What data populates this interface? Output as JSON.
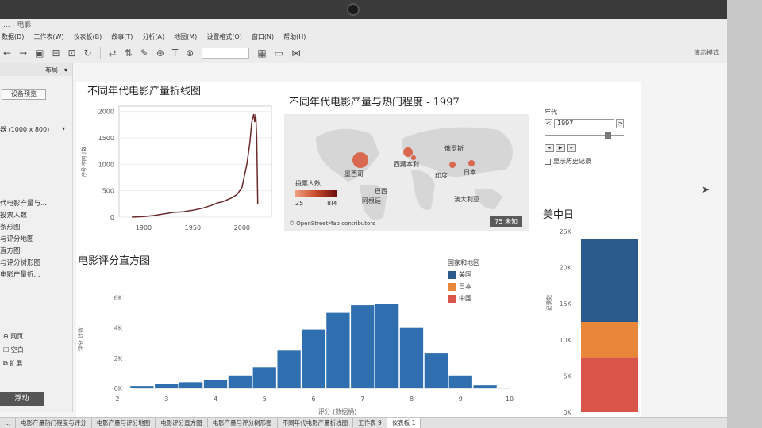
{
  "window": {
    "title": "... - 电影"
  },
  "menu": [
    "数据(D)",
    "工作表(W)",
    "仪表板(B)",
    "故事(T)",
    "分析(A)",
    "地图(M)",
    "设置格式(O)",
    "窗口(N)",
    "帮助(H)"
  ],
  "toolbar": {
    "present_label": "演示模式"
  },
  "sidebar": {
    "tab_label": "布局",
    "device_preview": "设备预览",
    "size_label": "器 (1000 x 800)",
    "sheets": [
      "代电影产量与...",
      "投票人数",
      "条形图",
      "与评分地图",
      "直方图",
      "与评分树形图",
      "电影产量折..."
    ],
    "objects": [
      {
        "icon": "globe-icon",
        "label": "网页"
      },
      {
        "icon": "blank-icon",
        "label": "空白"
      },
      {
        "icon": "extension-icon",
        "label": "扩展"
      }
    ],
    "float_button": "浮动"
  },
  "line_panel": {
    "title": "不同年代电影产量折线图"
  },
  "map_panel": {
    "title": "不同年代电影产量与热门程度 - 1997",
    "labels": [
      "俄罗斯",
      "西藏本利",
      "墨西哥",
      "印度",
      "日本",
      "巴西",
      "阿根廷",
      "澳大利亚"
    ],
    "legend_title": "投票人数",
    "legend_min": "25",
    "legend_max": "8M",
    "credit": "© OpenStreetMap contributors",
    "unknown_badge": "75 未知"
  },
  "year_filter": {
    "label": "年代",
    "value": "1997",
    "prev": "<",
    "next": ">",
    "history_label": "显示历史记录"
  },
  "hist_panel": {
    "title": "电影评分直方图"
  },
  "hist_legend": {
    "title": "国家和地区",
    "items": [
      {
        "label": "美国",
        "color": "#2a5b8c"
      },
      {
        "label": "日本",
        "color": "#e8873a"
      },
      {
        "label": "中国",
        "color": "#d9554a"
      }
    ]
  },
  "stack_panel": {
    "title": "美中日"
  },
  "tabs": [
    "...",
    "电影产量热门程度与评分",
    "电影产量与评分地图",
    "电影评分直方图",
    "电影产量与评分树形图",
    "不同年代电影产量折线图",
    "工作表 9",
    "仪表板 1"
  ],
  "colors": {
    "line": "#6b2a2a",
    "bar": "#2f6fb0"
  },
  "chart_data": [
    {
      "type": "line",
      "title": "不同年代电影产量折线图",
      "ylabel": "序号 不同计数",
      "xlabel": "",
      "x_ticks": [
        "1900",
        "1950",
        "2000"
      ],
      "y_ticks": [
        "0",
        "500",
        "1000",
        "1500",
        "2000"
      ],
      "xlim": [
        1875,
        2030
      ],
      "ylim": [
        0,
        2100
      ],
      "x": [
        1888,
        1900,
        1910,
        1920,
        1930,
        1940,
        1950,
        1960,
        1970,
        1975,
        1980,
        1985,
        1990,
        1995,
        2000,
        2005,
        2008,
        2010,
        2012,
        2013,
        2014,
        2015,
        2016
      ],
      "values": [
        0,
        10,
        30,
        60,
        90,
        100,
        130,
        170,
        230,
        270,
        290,
        330,
        370,
        430,
        560,
        1000,
        1400,
        1800,
        1950,
        1800,
        1950,
        1500,
        250
      ]
    },
    {
      "type": "bar",
      "title": "电影评分直方图",
      "xlabel": "评分 (数据桶)",
      "ylabel": "评分 计数",
      "x_ticks": [
        "2",
        "3",
        "4",
        "5",
        "6",
        "7",
        "8",
        "9",
        "10"
      ],
      "y_ticks": [
        "0K",
        "2K",
        "4K",
        "6K"
      ],
      "xlim": [
        2,
        10
      ],
      "ylim": [
        0,
        6500
      ],
      "bin_width": 0.5,
      "categories": [
        2.5,
        3,
        3.5,
        4,
        4.5,
        5,
        5.5,
        6,
        6.5,
        7,
        7.5,
        8,
        8.5,
        9,
        9.5
      ],
      "values": [
        150,
        300,
        400,
        560,
        850,
        1400,
        2500,
        3900,
        5000,
        5500,
        5600,
        4000,
        2300,
        850,
        200
      ]
    },
    {
      "type": "bar",
      "title": "美中日",
      "ylabel": "记录数",
      "y_ticks": [
        "0K",
        "5K",
        "10K",
        "15K",
        "20K",
        "25K"
      ],
      "ylim": [
        0,
        25000
      ],
      "series": [
        {
          "name": "中国",
          "values": [
            7500
          ]
        },
        {
          "name": "日本",
          "values": [
            5000
          ]
        },
        {
          "name": "美国",
          "values": [
            11500
          ]
        }
      ]
    }
  ]
}
